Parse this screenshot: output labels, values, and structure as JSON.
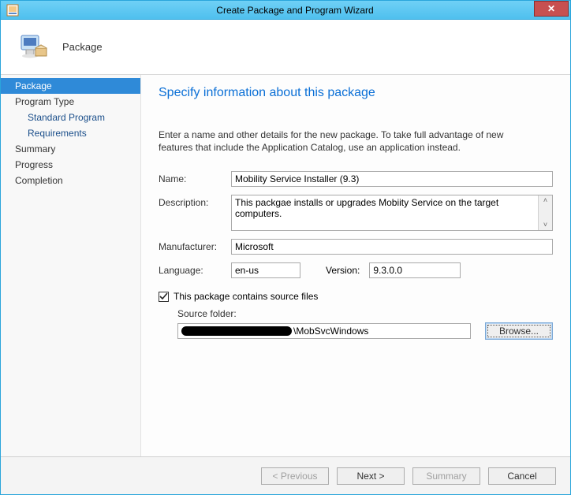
{
  "window": {
    "title": "Create Package and Program Wizard",
    "close_glyph": "✕"
  },
  "header": {
    "label": "Package"
  },
  "sidebar": {
    "items": [
      {
        "label": "Package",
        "selected": true,
        "sub": false
      },
      {
        "label": "Program Type",
        "selected": false,
        "sub": false
      },
      {
        "label": "Standard Program",
        "selected": false,
        "sub": true
      },
      {
        "label": "Requirements",
        "selected": false,
        "sub": true
      },
      {
        "label": "Summary",
        "selected": false,
        "sub": false
      },
      {
        "label": "Progress",
        "selected": false,
        "sub": false
      },
      {
        "label": "Completion",
        "selected": false,
        "sub": false
      }
    ]
  },
  "page": {
    "title": "Specify information about this package",
    "instructions": "Enter a name and other details for the new package. To take full advantage of new features that include the Application Catalog, use an application instead."
  },
  "form": {
    "name_label": "Name:",
    "name_value": "Mobility Service Installer (9.3)",
    "description_label": "Description:",
    "description_value": "This packgae installs or upgrades Mobiity Service on the target computers.",
    "manufacturer_label": "Manufacturer:",
    "manufacturer_value": "Microsoft",
    "language_label": "Language:",
    "language_value": "en-us",
    "version_label": "Version:",
    "version_value": "9.3.0.0",
    "source_checkbox_label": "This package contains source files",
    "source_checkbox_checked": true,
    "source_folder_label": "Source folder:",
    "source_folder_suffix": "\\MobSvcWindows",
    "browse_label": "Browse..."
  },
  "footer": {
    "previous": "< Previous",
    "next": "Next >",
    "summary": "Summary",
    "cancel": "Cancel"
  }
}
